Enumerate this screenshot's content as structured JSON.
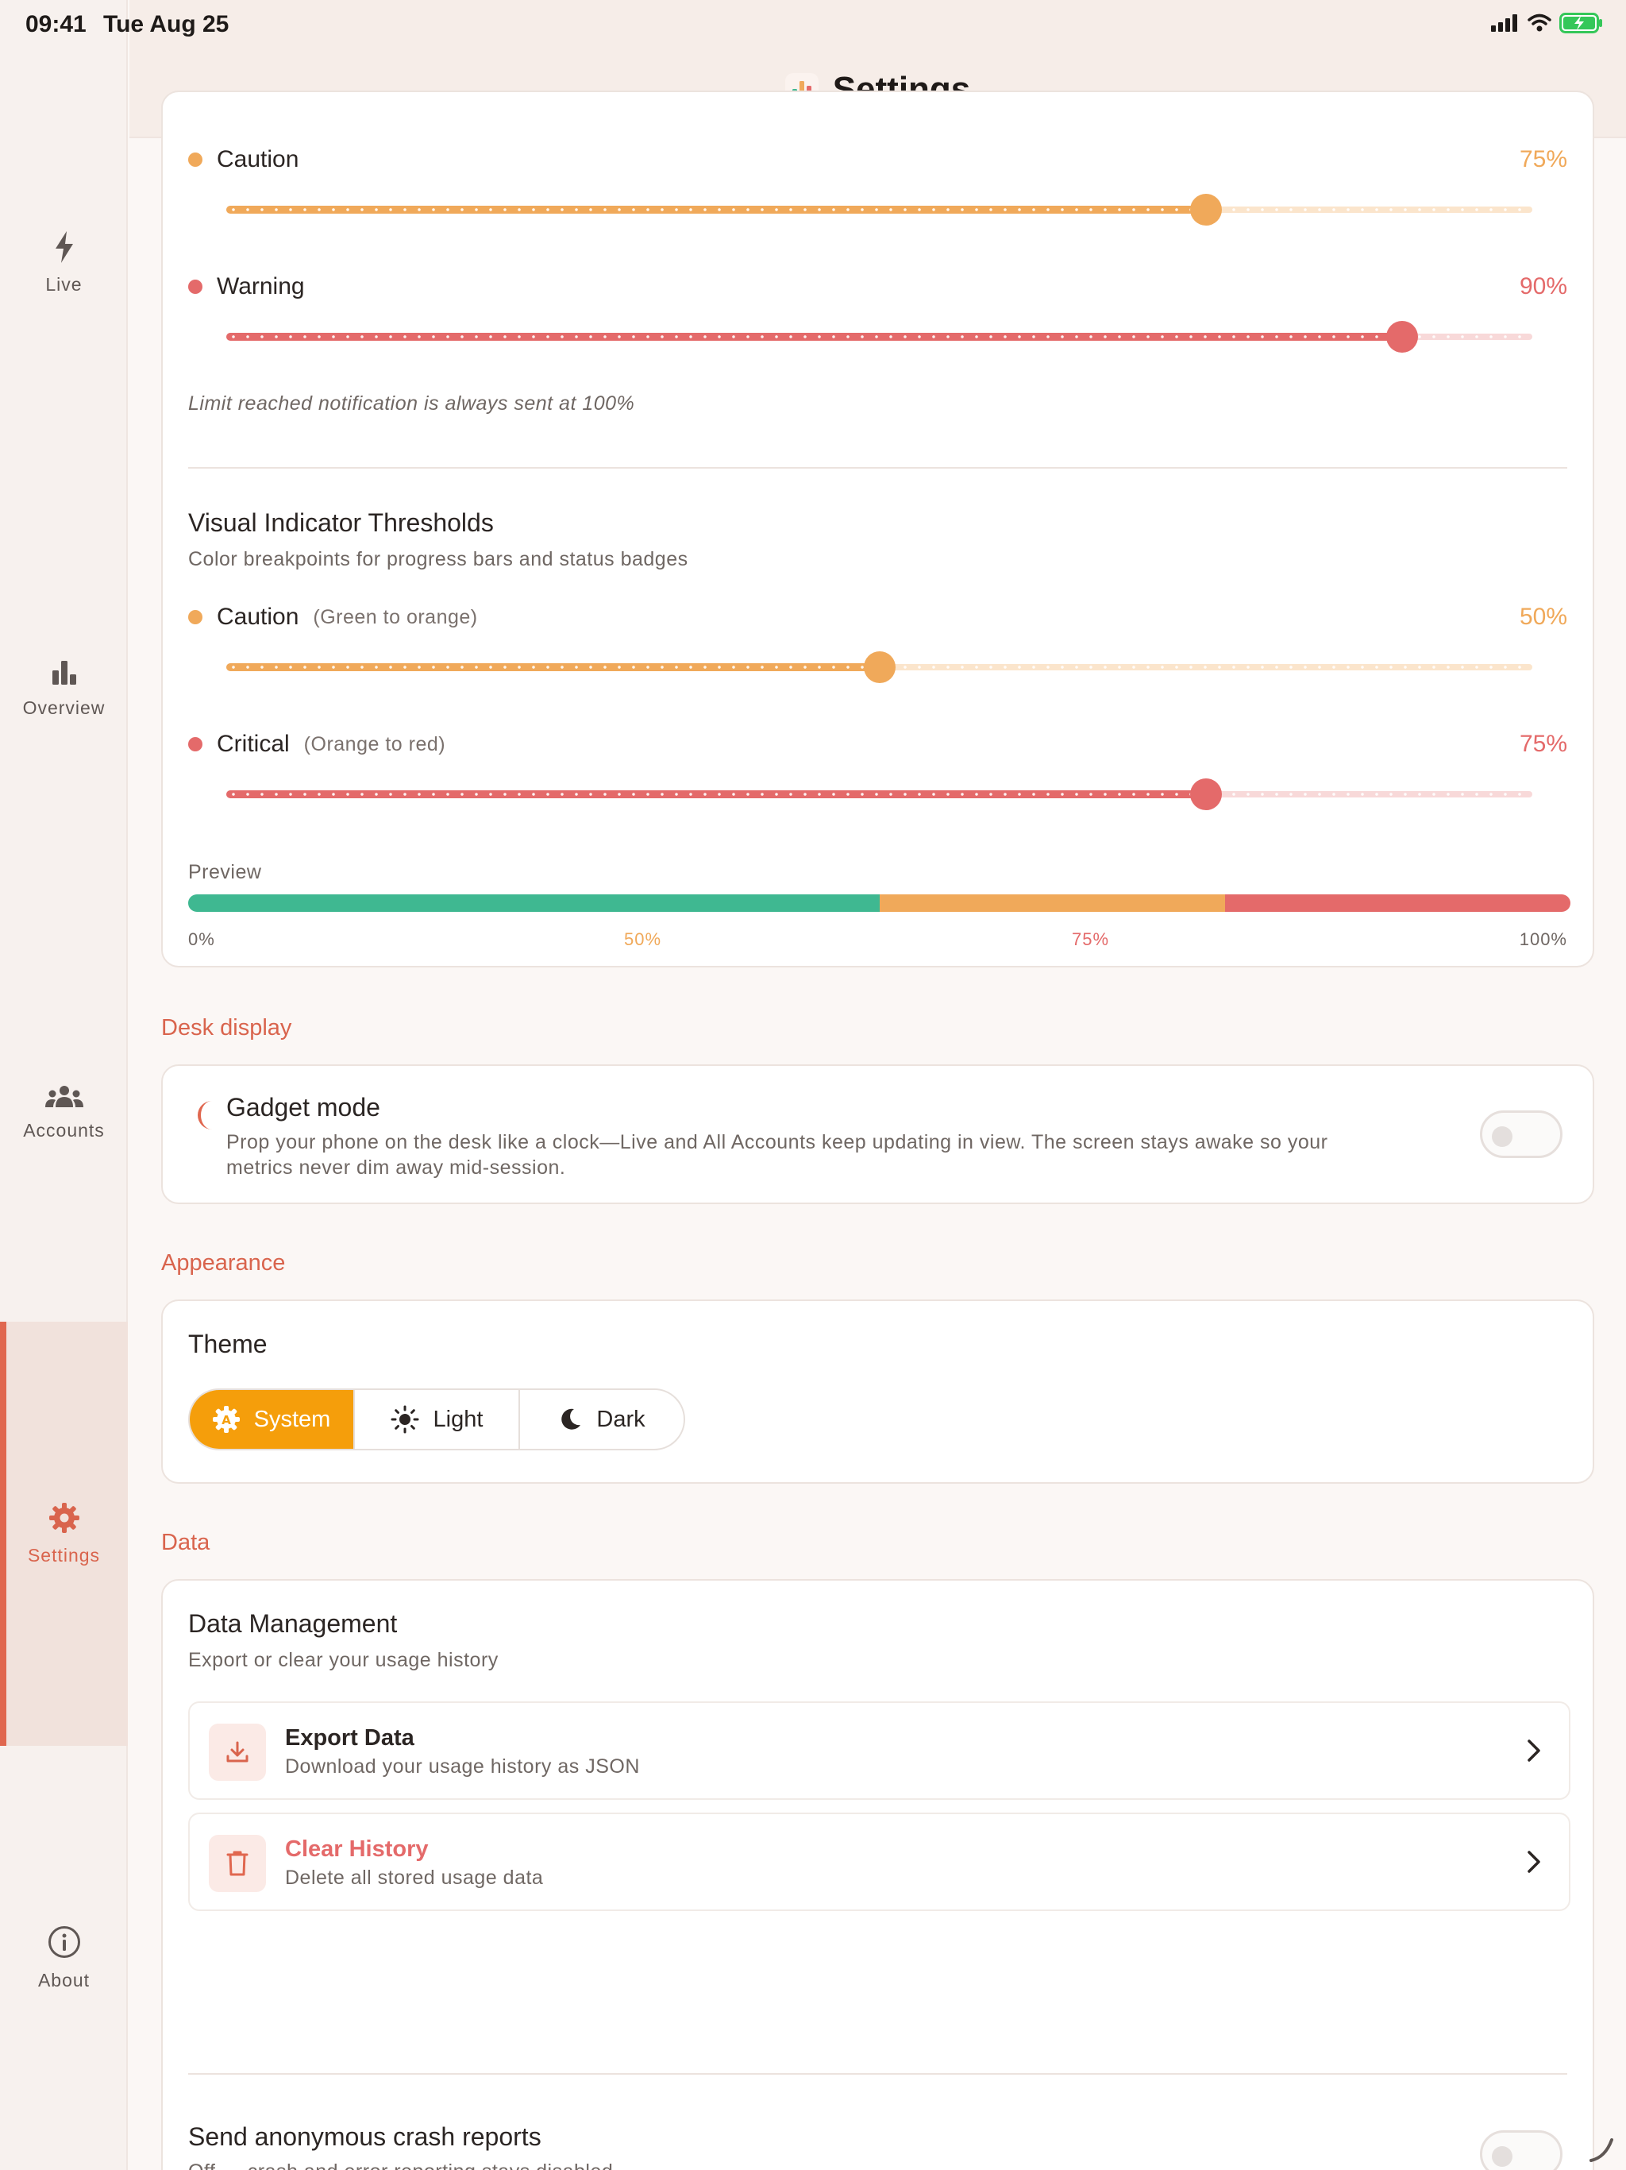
{
  "status_bar": {
    "time": "09:41",
    "date": "Tue Aug 25"
  },
  "header": {
    "title": "Settings",
    "app_icon": "bar-chart-app-icon"
  },
  "sidebar": {
    "items": [
      {
        "label": "Live",
        "icon": "bolt-icon",
        "active": false
      },
      {
        "label": "Overview",
        "icon": "bar-chart-icon",
        "active": false
      },
      {
        "label": "Accounts",
        "icon": "people-icon",
        "active": true
      },
      {
        "label": "Settings",
        "icon": "gear-icon",
        "active": true
      },
      {
        "label": "About",
        "icon": "info-icon",
        "active": false
      }
    ]
  },
  "notification_thresholds": {
    "caution": {
      "label": "Caution",
      "value_text": "75%",
      "value": 0.75
    },
    "warning": {
      "label": "Warning",
      "value_text": "90%",
      "value": 0.9
    },
    "note": "Limit reached notification is always sent at 100%"
  },
  "visual_thresholds": {
    "title": "Visual Indicator Thresholds",
    "description": "Color breakpoints for progress bars and status badges",
    "caution": {
      "label": "Caution",
      "sub": "(Green to orange)",
      "value_text": "50%",
      "value": 0.5
    },
    "critical": {
      "label": "Critical",
      "sub": "(Orange to red)",
      "value_text": "75%",
      "value": 0.75
    },
    "preview_label": "Preview",
    "preview_ticks": [
      "0%",
      "50%",
      "75%",
      "100%"
    ]
  },
  "desk_display": {
    "section": "Desk display",
    "title": "Gadget mode",
    "description_line1": "Prop your phone on the desk like a clock—Live and All Accounts keep updating in view. The screen stays awake so your",
    "description_line2": "metrics never dim away mid-session.",
    "enabled": false
  },
  "appearance": {
    "section": "Appearance",
    "title": "Theme",
    "options": [
      "System",
      "Light",
      "Dark"
    ],
    "selected": "System"
  },
  "data": {
    "section": "Data",
    "title": "Data Management",
    "description": "Export or clear your usage history",
    "export": {
      "title": "Export Data",
      "sub": "Download your usage history as JSON"
    },
    "clear": {
      "title": "Clear History",
      "sub": "Delete all stored usage data"
    },
    "crash_reports": {
      "title": "Send anonymous crash reports",
      "sub": "Off — crash and error reporting stays disabled.",
      "enabled": false
    }
  },
  "colors": {
    "accent": "#d9644d",
    "orange": "#f0a95a",
    "red": "#e46a6a",
    "green": "#3fb891",
    "segment_active": "#f59e0b"
  }
}
